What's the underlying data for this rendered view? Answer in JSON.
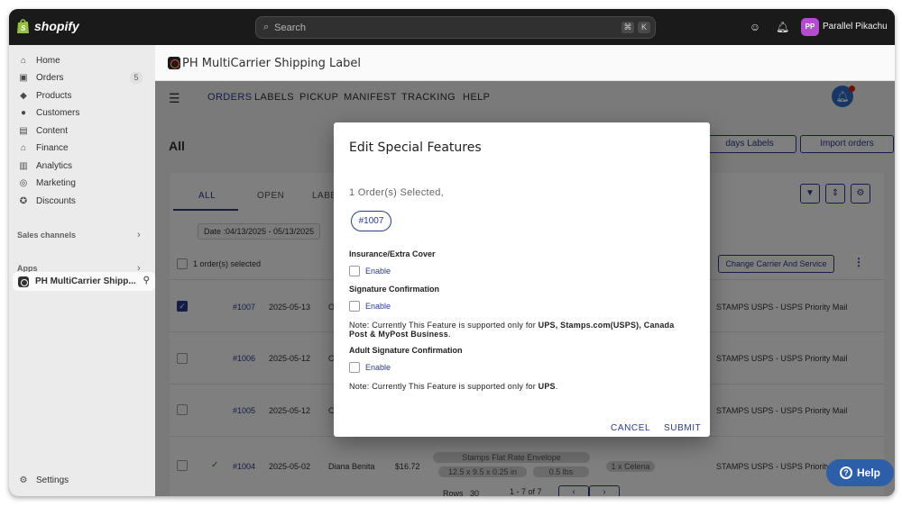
{
  "topbar": {
    "brand": "shopify",
    "search_placeholder": "Search",
    "kbd_cmd": "⌘",
    "kbd_k": "K",
    "avatar_initials": "PP",
    "user_name": "Parallel Pikachu"
  },
  "sidebar": {
    "items": [
      {
        "label": "Home",
        "icon": "home-icon"
      },
      {
        "label": "Orders",
        "icon": "orders-icon",
        "badge": "5"
      },
      {
        "label": "Products",
        "icon": "tag-icon"
      },
      {
        "label": "Customers",
        "icon": "person-icon"
      },
      {
        "label": "Content",
        "icon": "content-icon"
      },
      {
        "label": "Finance",
        "icon": "bank-icon"
      },
      {
        "label": "Analytics",
        "icon": "chart-icon"
      },
      {
        "label": "Marketing",
        "icon": "target-icon"
      },
      {
        "label": "Discounts",
        "icon": "discount-icon"
      }
    ],
    "sales_channels": "Sales channels",
    "apps": "Apps",
    "app_item": "PH MultiCarrier Shipp...",
    "settings": "Settings"
  },
  "app_header": {
    "title": "PH MultiCarrier Shipping Label"
  },
  "menu": [
    "ORDERS",
    "LABELS",
    "PICKUP",
    "MANIFEST",
    "TRACKING",
    "HELP"
  ],
  "page": {
    "title": "All",
    "btn_todays_labels": "days Labels",
    "btn_import": "Import orders",
    "tabs": [
      "ALL",
      "OPEN",
      "LABELE"
    ],
    "date_filter": "Date :04/13/2025 - 05/13/2025",
    "selected_text": "1 order(s) selected",
    "change_carrier": "Change Carrier And Service"
  },
  "orders": [
    {
      "id": "#1007",
      "date": "2025-05-13",
      "customer": "Oliv",
      "service": "STAMPS USPS - USPS Priority Mail",
      "checked": true
    },
    {
      "id": "#1006",
      "date": "2025-05-12",
      "customer": "Car",
      "service": "STAMPS USPS - USPS Priority Mail",
      "checked": false
    },
    {
      "id": "#1005",
      "date": "2025-05-12",
      "customer": "Car",
      "service": "STAMPS USPS - USPS Priority Mail",
      "checked": false
    },
    {
      "id": "#1004",
      "date": "2025-05-02",
      "customer": "Diana Benita",
      "amount": "$16.72",
      "package": "Stamps Flat Rate Envelope",
      "dims": "12.5 x 9.5 x 0.25 in",
      "weight": "0.5 lbs",
      "item": "1 x Celena",
      "service": "STAMPS USPS - USPS Priority Mail",
      "checked": false,
      "fulfilled_mark": "✓"
    }
  ],
  "pager": {
    "rows_label": "Rows",
    "rows_value": "30",
    "range": "1 - 7 of 7",
    "prev": "‹",
    "next": "›"
  },
  "dialog": {
    "title": "Edit Special Features",
    "selected": "1 Order(s) Selected,",
    "order_chip": "#1007",
    "features": [
      {
        "title": "Insurance/Extra Cover",
        "enable": "Enable"
      },
      {
        "title": "Signature Confirmation",
        "enable": "Enable"
      },
      {
        "title": "Adult Signature Confirmation",
        "enable": "Enable"
      }
    ],
    "note1_prefix": "Note: Currently This Feature is supported only for ",
    "note1_bold": "UPS, Stamps.com(USPS), Canada Post & MyPost Business",
    "note1_suffix": ".",
    "note2_prefix": "Note: Currently This Feature is supported only for ",
    "note2_bold": "UPS",
    "note2_suffix": ".",
    "cancel": "CANCEL",
    "submit": "SUBMIT"
  },
  "help": {
    "label": "Help"
  },
  "colors": {
    "accent": "#2a3a8f",
    "topbar": "#1a1a1a",
    "sidebar": "#ebebeb",
    "help_button": "#2c5fa8",
    "avatar": "#b44bd1"
  }
}
